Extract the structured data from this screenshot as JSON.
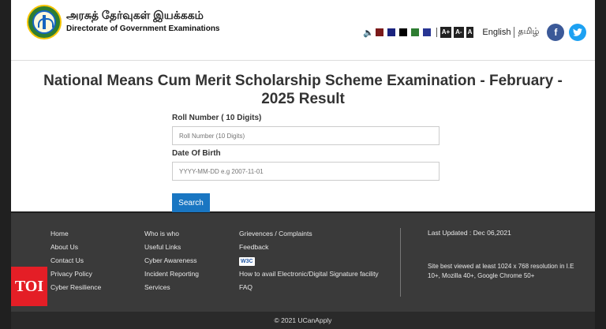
{
  "header": {
    "org_tamil": "அரசுத் தேர்வுகள் இயக்ககம்",
    "org_english": "Directorate of Government Examinations",
    "speaker_icon": "speaker-icon",
    "theme_colors": [
      "#7b1a1a",
      "#1a237e",
      "#000000",
      "#2e7d32",
      "#283593"
    ],
    "font_sizes": [
      "A+",
      "A-",
      "A"
    ],
    "lang_english": "English",
    "lang_tamil": "தமிழ்",
    "facebook": "f",
    "twitter": "t",
    "brand_blue": "#1976c2"
  },
  "form": {
    "title": "National Means Cum Merit Scholarship Scheme Examination - February - 2025 Result",
    "roll_label": "Roll Number ( 10 Digits)",
    "roll_placeholder": "Roll Number (10 Digits)",
    "dob_label": "Date Of Birth",
    "dob_placeholder": "YYYY-MM-DD e.g 2007-11-01",
    "search_button": "Search"
  },
  "footer": {
    "col1": [
      "Home",
      "About Us",
      "Contact Us",
      "Privacy Policy",
      "Cyber Resilience"
    ],
    "col2": [
      "Who is who",
      "Useful Links",
      "Cyber Awareness",
      "Incident Reporting",
      "Services"
    ],
    "col3": [
      "Grievences / Complaints",
      "Feedback",
      "W3C",
      "How to avail Electronic/Digital Signature facility",
      "FAQ"
    ],
    "last_updated": "Last Updated : Dec 06,2021",
    "best_viewed": "Site best viewed at least 1024 x 768 resolution in I.E 10+, Mozilla 40+, Google Chrome 50+",
    "copyright": "© 2021 UCanApply"
  },
  "watermark": "TOI"
}
